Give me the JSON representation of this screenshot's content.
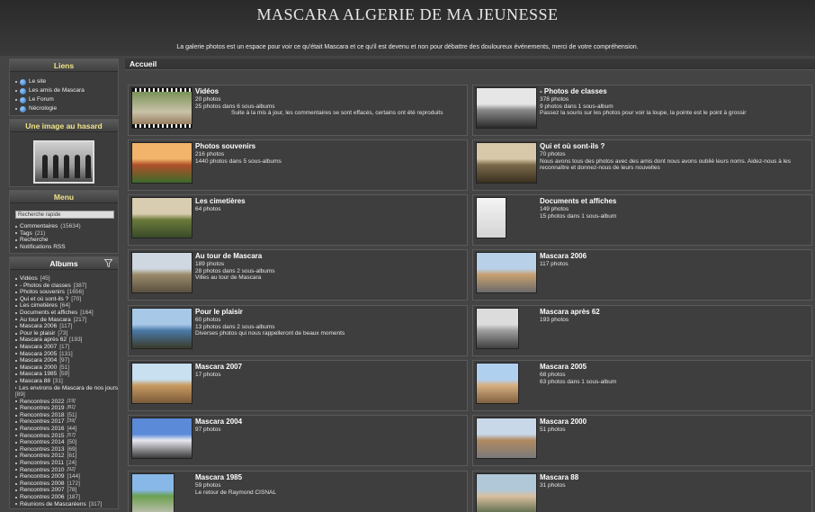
{
  "site": {
    "title": "MASCARA ALGERIE DE MA JEUNESSE",
    "description": "La galerie photos est un espace pour voir ce qu'était Mascara et ce qu'il est devenu et non pour débattre des douloureux événements, merci de votre compréhension."
  },
  "sidebar": {
    "links": {
      "title": "Liens",
      "items": [
        "Le site",
        "Les amis de Mascara",
        "Le Forum",
        "Nécrologie"
      ]
    },
    "random": {
      "title": "Une image au hasard"
    },
    "menu": {
      "title": "Menu",
      "search_placeholder": "Recherche rapide",
      "items": [
        {
          "label": "Commentaires",
          "count": "(15634)"
        },
        {
          "label": "Tags",
          "count": "(21)"
        },
        {
          "label": "Recherche",
          "count": ""
        },
        {
          "label": "Notifications RSS",
          "count": ""
        }
      ]
    },
    "albums": {
      "title": "Albums",
      "items": [
        {
          "label": "Vidéos",
          "count": "[45]",
          "italic": false
        },
        {
          "label": "- Photos de classes",
          "count": "[387]",
          "italic": false
        },
        {
          "label": "Photos souvenirs",
          "count": "[1656]",
          "italic": false
        },
        {
          "label": "Qui et où sont-ils ?",
          "count": "[70]",
          "italic": false
        },
        {
          "label": "Les cimetières",
          "count": "[64]",
          "italic": false
        },
        {
          "label": "Documents et affiches",
          "count": "[164]",
          "italic": false
        },
        {
          "label": "Au tour de Mascara",
          "count": "[217]",
          "italic": false
        },
        {
          "label": "Mascara 2006",
          "count": "[117]",
          "italic": false
        },
        {
          "label": "Pour le plaisir",
          "count": "[73]",
          "italic": false
        },
        {
          "label": "Mascara après 62",
          "count": "[193]",
          "italic": false
        },
        {
          "label": "Mascara 2007",
          "count": "[17]",
          "italic": false
        },
        {
          "label": "Mascara 2005",
          "count": "[131]",
          "italic": false
        },
        {
          "label": "Mascara 2004",
          "count": "[97]",
          "italic": false
        },
        {
          "label": "Mascara 2000",
          "count": "[51]",
          "italic": false
        },
        {
          "label": "Mascara 1985",
          "count": "[59]",
          "italic": false
        },
        {
          "label": "Mascara 88",
          "count": "[31]",
          "italic": false
        },
        {
          "label": "Les environs de Mascara de nos jours",
          "count": "",
          "italic": false
        },
        {
          "label": "[89]",
          "count": "",
          "italic": false,
          "continuation": true
        },
        {
          "label": "Rencontres 2022",
          "count": "[19]",
          "italic": true
        },
        {
          "label": "Rencontres 2019",
          "count": "[81]",
          "italic": true
        },
        {
          "label": "Rencontres 2018",
          "count": "[51]",
          "italic": false
        },
        {
          "label": "Rencontres 2017",
          "count": "[39]",
          "italic": true
        },
        {
          "label": "Rencontres 2016",
          "count": "[44]",
          "italic": false
        },
        {
          "label": "Rencontres 2015",
          "count": "[57]",
          "italic": true
        },
        {
          "label": "Rencontres 2014",
          "count": "[50]",
          "italic": false
        },
        {
          "label": "Rencontres 2013",
          "count": "[69]",
          "italic": false
        },
        {
          "label": "Rencontres 2012",
          "count": "[61]",
          "italic": false
        },
        {
          "label": "Rencontres 2011",
          "count": "[24]",
          "italic": false
        },
        {
          "label": "Rencontres 2010",
          "count": "[92]",
          "italic": true
        },
        {
          "label": "Rencontres 2009",
          "count": "[144]",
          "italic": false
        },
        {
          "label": "Rencontres 2008",
          "count": "[172]",
          "italic": false
        },
        {
          "label": "Rencontres 2007",
          "count": "[78]",
          "italic": false
        },
        {
          "label": "Rencontres 2006",
          "count": "[187]",
          "italic": false
        },
        {
          "label": "Réunions de Mascaréens",
          "count": "[317]",
          "italic": false
        }
      ]
    }
  },
  "breadcrumb": "Accueil",
  "cards": [
    {
      "title": "Vidéos",
      "lines": [
        "20 photos",
        "25 photos dans 6 sous-albums"
      ],
      "desc": "Suite à la mis à jour, les commentaires se sont effacés, certains ont été reproduits",
      "desc_indent": true,
      "thumb": "video"
    },
    {
      "title": "- Photos de classes",
      "lines": [
        "378 photos",
        "9 photos dans 1 sous-album"
      ],
      "desc": "Passez la souris sur les photos pour voir la loupe, la pointe est le point à grossir",
      "desc_indent": false,
      "thumb": "class"
    },
    {
      "title": "Photos souvenirs",
      "lines": [
        "216 photos",
        "1440 photos dans 5 sous-albums"
      ],
      "desc": "",
      "thumb": "kiosk"
    },
    {
      "title": "Qui et où sont-ils ?",
      "lines": [
        "70 photos"
      ],
      "desc": "Nous avons tous des photos avec des amis dont nous avons oublié leurs noms. Aidez-nous à les reconnaître et donnez-nous de leurs nouvelles",
      "thumb": "group"
    },
    {
      "title": "Les cimetières",
      "lines": [
        "64 photos"
      ],
      "desc": "",
      "thumb": "cemetery"
    },
    {
      "title": "Documents et affiches",
      "lines": [
        "149 photos",
        "15 photos dans 1 sous-album"
      ],
      "desc": "",
      "thumb": "doc"
    },
    {
      "title": "Au tour de Mascara",
      "lines": [
        "189 photos",
        "28 photos dans 2 sous-albums",
        "Villes au tour de Mascara"
      ],
      "desc": "",
      "thumb": "town"
    },
    {
      "title": "Mascara 2006",
      "lines": [
        "117 photos"
      ],
      "desc": "",
      "thumb": "street"
    },
    {
      "title": "Pour le plaisir",
      "lines": [
        "60 photos",
        "13 photos dans 2 sous-albums",
        "Diverses photos qui nous rappelleront de beaux moments"
      ],
      "desc": "",
      "thumb": "coast"
    },
    {
      "title": "Mascara après 62",
      "lines": [
        "193 photos"
      ],
      "desc": "",
      "thumb": "aerial"
    },
    {
      "title": "Mascara 2007",
      "lines": [
        "17 photos"
      ],
      "desc": "",
      "thumb": "alley"
    },
    {
      "title": "Mascara 2005",
      "lines": [
        "68 photos",
        "63 photos dans 1 sous-album"
      ],
      "desc": "",
      "thumb": "building"
    },
    {
      "title": "Mascara 2004",
      "lines": [
        "97 photos"
      ],
      "desc": "",
      "thumb": "plaza"
    },
    {
      "title": "Mascara 2000",
      "lines": [
        "51 photos"
      ],
      "desc": "",
      "thumb": "road"
    },
    {
      "title": "Mascara 1985",
      "lines": [
        "59 photos",
        "Le retour de Raymond CISNAL"
      ],
      "desc": "",
      "thumb": "park"
    },
    {
      "title": "Mascara 88",
      "lines": [
        "31 photos"
      ],
      "desc": "",
      "thumb": "car"
    }
  ],
  "thumb_palettes": {
    "video": [
      "#1a1a1a",
      "#6b8a4a",
      "#c9c2a8"
    ],
    "class": [
      "#e6e6e6",
      "#8a8a8a",
      "#2a2a2a"
    ],
    "kiosk": [
      "#f2b46a",
      "#b0502a",
      "#3c6a2a"
    ],
    "group": [
      "#d6c8a8",
      "#7a6a4a",
      "#3a3020"
    ],
    "cemetery": [
      "#d8cdb0",
      "#6a7a3a",
      "#3a4a2a"
    ],
    "doc": [
      "#f2f2f2",
      "#cfcfcf",
      "#555555"
    ],
    "town": [
      "#cfd8e0",
      "#9a8a6a",
      "#5a5040"
    ],
    "street": [
      "#b8d0e8",
      "#c8a070",
      "#6a6a6a"
    ],
    "coast": [
      "#a8c8e8",
      "#4a7aa8",
      "#3a3a2a"
    ],
    "aerial": [
      "#dcdcdc",
      "#a0a0a0",
      "#404040"
    ],
    "alley": [
      "#c8e0f0",
      "#c89a60",
      "#7a5a3a"
    ],
    "building": [
      "#b0d0f0",
      "#d8b080",
      "#806040"
    ],
    "plaza": [
      "#5a8ad8",
      "#e8e8f0",
      "#3a3a3a"
    ],
    "road": [
      "#c8d8e8",
      "#b08a60",
      "#7a7a7a"
    ],
    "park": [
      "#88b8e8",
      "#6aa050",
      "#c0c0b0"
    ],
    "car": [
      "#b0c8d8",
      "#d8c0a0",
      "#5a6a4a"
    ]
  }
}
